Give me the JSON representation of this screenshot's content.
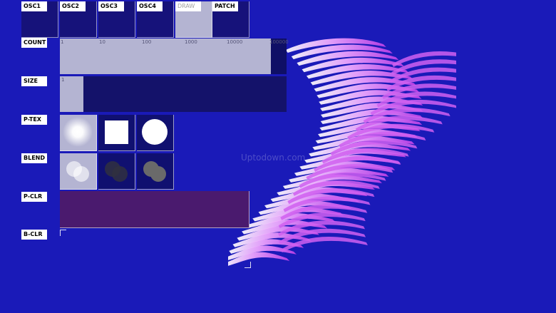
{
  "tabs": [
    {
      "label": "OSC1",
      "active": false
    },
    {
      "label": "OSC2",
      "active": false
    },
    {
      "label": "OSC3",
      "active": false
    },
    {
      "label": "OSC4",
      "active": false
    },
    {
      "label": "DRAW",
      "active": true
    },
    {
      "label": "PATCH",
      "active": false
    }
  ],
  "rows": {
    "count": "COUNT",
    "size": "SIZE",
    "p_tex": "P-TEX",
    "blend": "BLEND",
    "p_clr": "P-CLR",
    "b_clr": "B-CLR"
  },
  "count_slider": {
    "ticks": [
      "1",
      "10",
      "100",
      "1000",
      "10000",
      "100000"
    ],
    "value_fraction": 0.93
  },
  "size_slider": {
    "label": "1",
    "value_fraction": 0.105
  },
  "textures": [
    "soft-glow-icon",
    "square-icon",
    "circle-icon"
  ],
  "blend_modes": [
    "blend-add-icon",
    "blend-multiply-icon",
    "blend-normal-icon"
  ],
  "watermark": "Uptodown.com",
  "colors": {
    "background": "#1a1ab8",
    "panel": "#16127a",
    "selected": "#b4b4d2",
    "particle_color": "#4a1a6e",
    "ribbon": "#e070f0"
  }
}
